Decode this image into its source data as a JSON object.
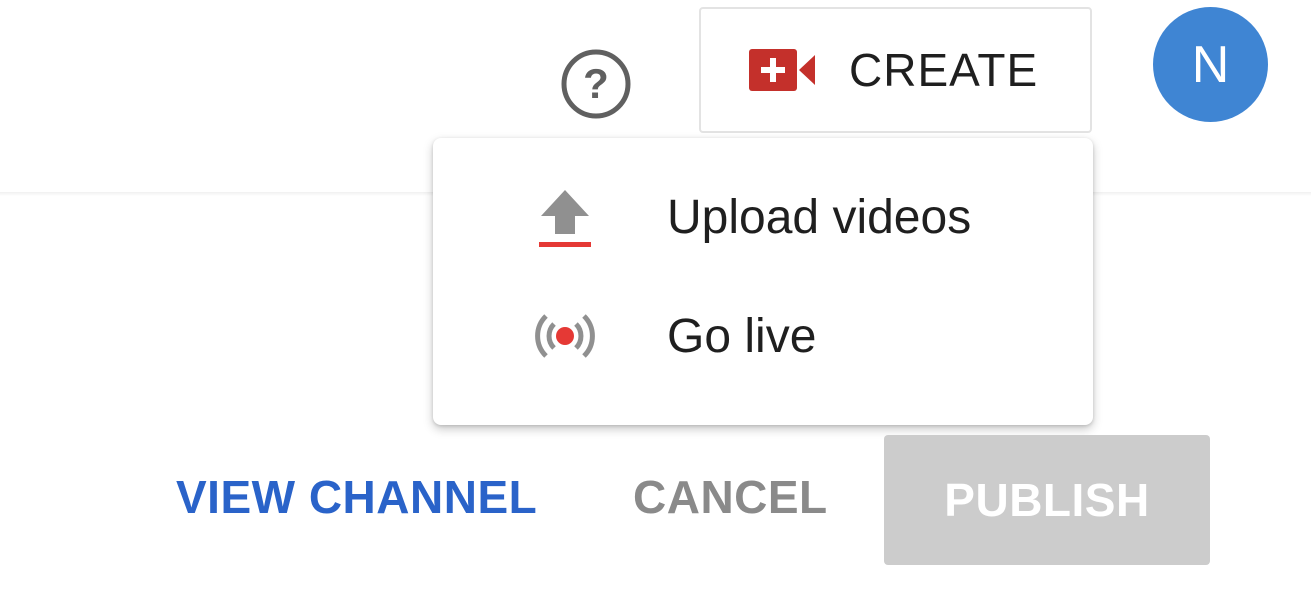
{
  "topbar": {
    "help_icon": "help-circle-icon",
    "create": {
      "icon": "video-camera-add-icon",
      "label": "CREATE"
    },
    "avatar": {
      "initial": "N",
      "color": "#3f85d3"
    }
  },
  "create_menu": {
    "items": [
      {
        "label": "Upload videos",
        "icon": "upload-icon"
      },
      {
        "label": "Go live",
        "icon": "live-broadcast-icon"
      }
    ]
  },
  "actions": {
    "view_channel": "VIEW CHANNEL",
    "cancel": "CANCEL",
    "publish": "PUBLISH"
  },
  "colors": {
    "accent_red": "#c4302b",
    "link_blue": "#2a63c9",
    "disabled_gray": "#cccccc",
    "icon_gray": "#909090"
  }
}
